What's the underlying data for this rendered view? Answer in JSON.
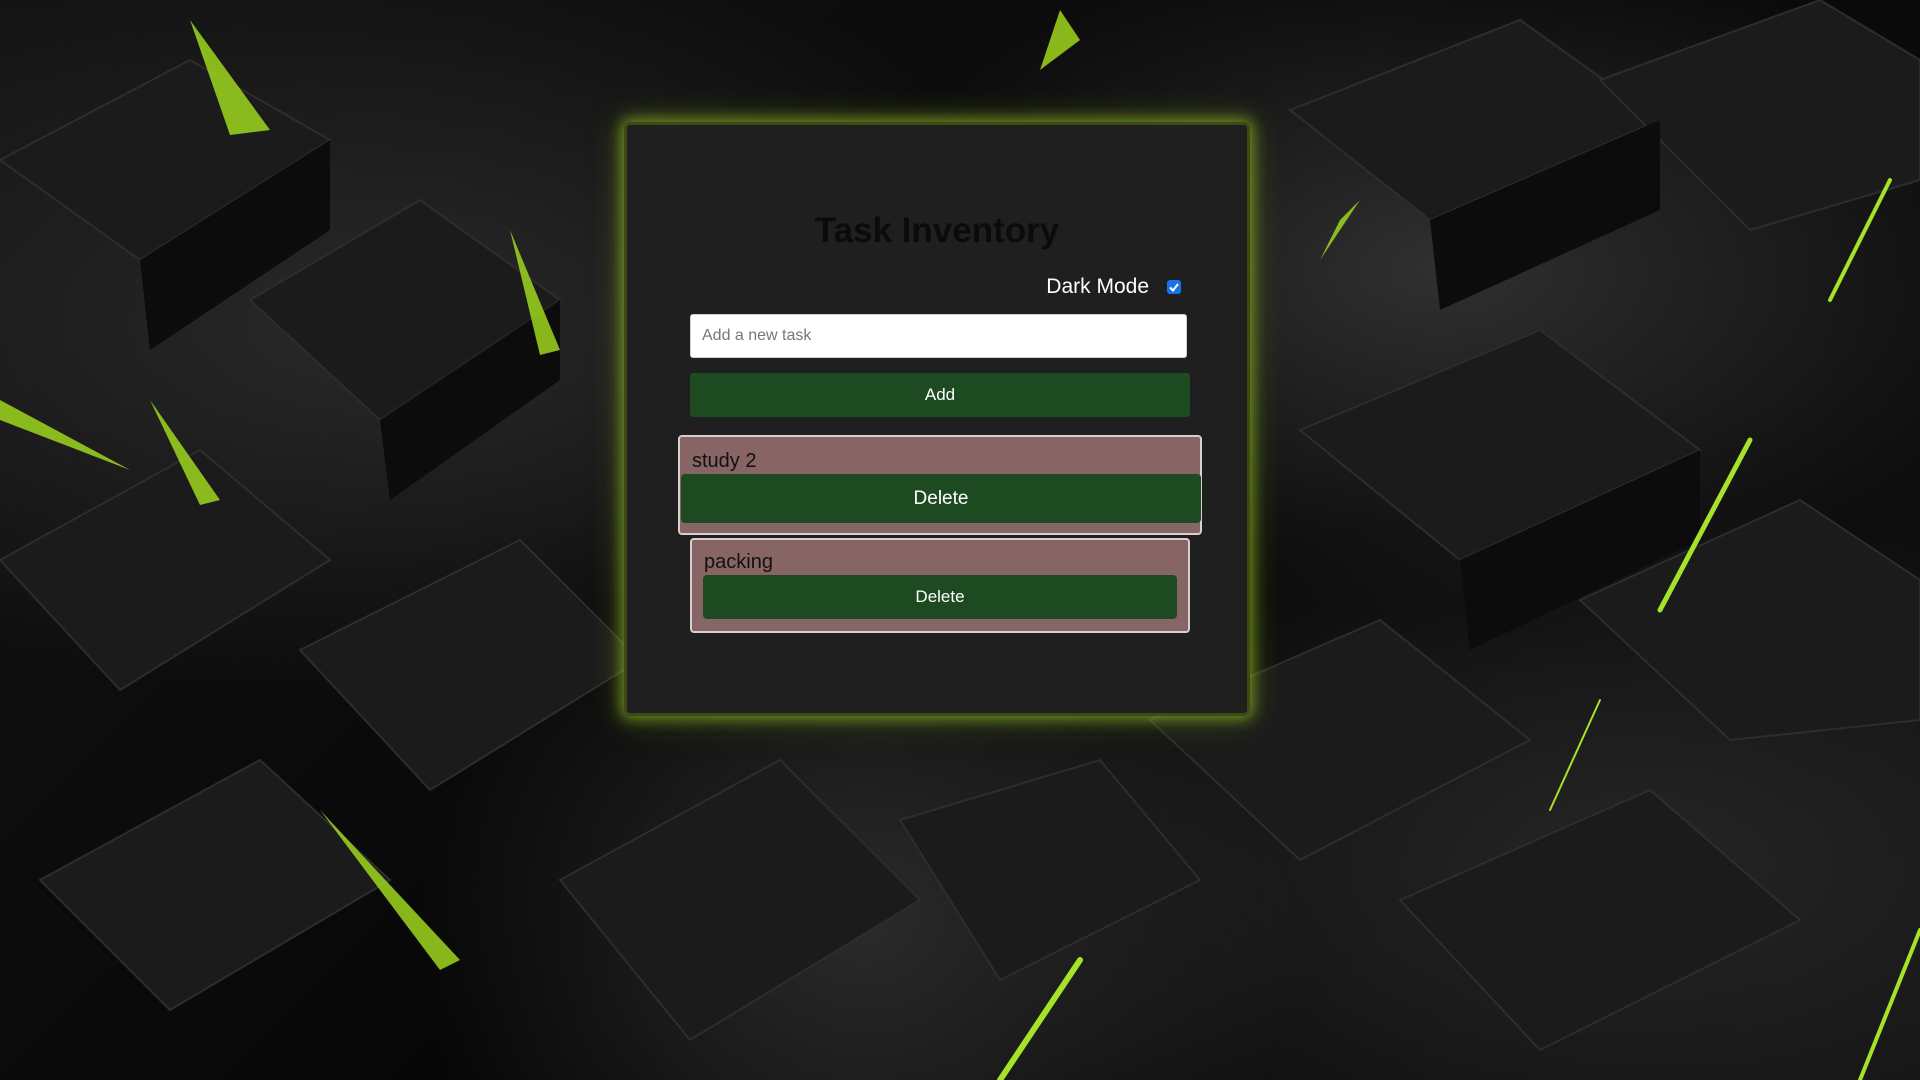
{
  "app": {
    "title": "Task Inventory"
  },
  "dark_mode": {
    "label": "Dark Mode",
    "checked": true
  },
  "new_task": {
    "placeholder": "Add a new task",
    "value": ""
  },
  "add_button": {
    "label": "Add"
  },
  "tasks": [
    {
      "name": "study 2",
      "delete_label": "Delete"
    },
    {
      "name": "packing",
      "delete_label": "Delete"
    }
  ],
  "colors": {
    "background": "#050505",
    "card": "#1f1f1f",
    "glow": "#aadc28",
    "button": "#1e4a21",
    "task_item": "#886565",
    "checkbox": "#1a73e8"
  }
}
